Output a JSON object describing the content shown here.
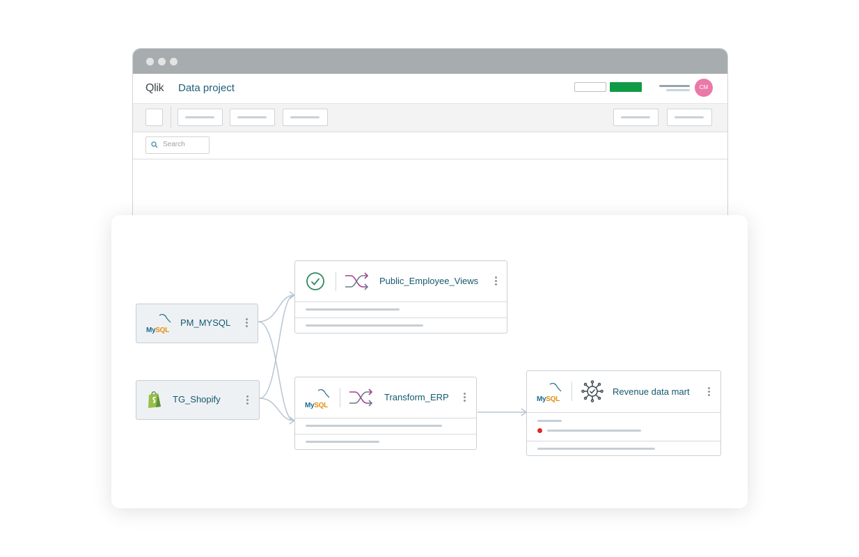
{
  "window": {
    "logo_text": "Qlik",
    "app_title": "Data project",
    "avatar_initials": "CM",
    "search_placeholder": "Search"
  },
  "flow": {
    "sources": [
      {
        "name": "PM_MYSQL",
        "icon": "mysql-logo"
      },
      {
        "name": "TG_Shopify",
        "icon": "shopify-logo"
      }
    ],
    "tasks": [
      {
        "name": "Public_Employee_Views",
        "status_icon": "check-circle-icon",
        "type_icon": "shuffle-icon"
      },
      {
        "name": "Transform_ERP",
        "status_icon": "mysql-logo",
        "type_icon": "shuffle-icon"
      },
      {
        "name": "Revenue data mart",
        "status_icon": "mysql-logo",
        "type_icon": "gear-network-icon",
        "error": true
      }
    ],
    "mysql_logo": {
      "my": "My",
      "sql": "SQL"
    }
  },
  "colors": {
    "accent_green": "#0f9b45",
    "avatar_pink": "#ea79a9",
    "node_label": "#14586f",
    "error_dot": "#e3262a",
    "shuffle_purple": "#a63c8f"
  }
}
